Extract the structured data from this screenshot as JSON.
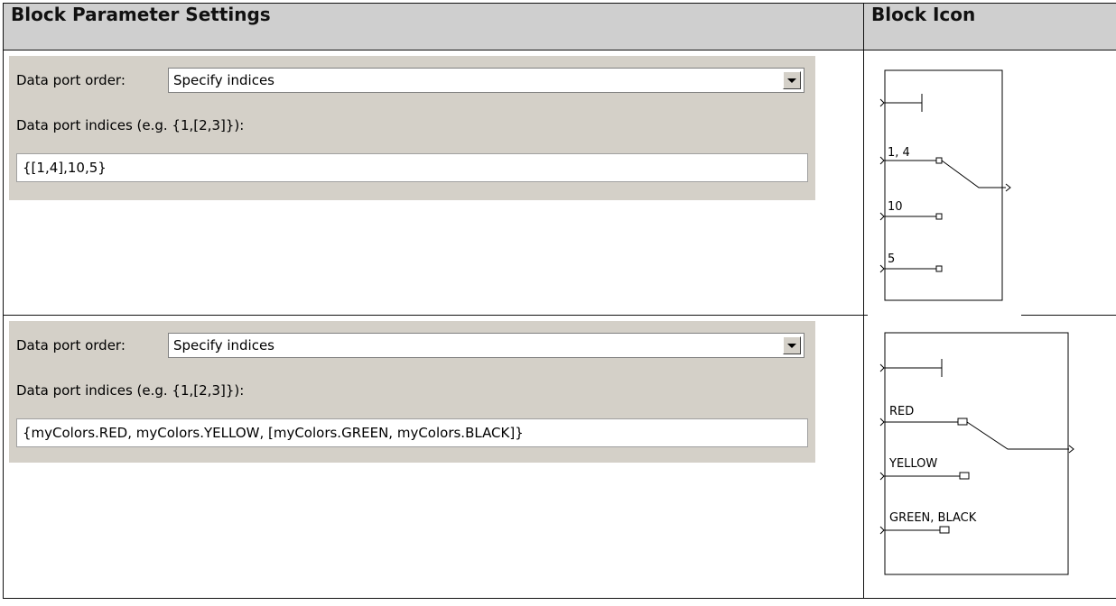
{
  "header": {
    "col1": "Block Parameter Settings",
    "col2": "Block Icon"
  },
  "rows": [
    {
      "order_label": "Data port order:",
      "order_value": "Specify indices",
      "indices_label": "Data port indices (e.g. {1,[2,3]}):",
      "indices_value": "{[1,4],10,5}",
      "icon_ports": [
        "1, 4",
        "10",
        "5"
      ]
    },
    {
      "order_label": "Data port order:",
      "order_value": "Specify indices",
      "indices_label": "Data port indices (e.g. {1,[2,3]}):",
      "indices_value": "{myColors.RED, myColors.YELLOW, [myColors.GREEN, myColors.BLACK]}",
      "icon_ports": [
        "RED",
        "YELLOW",
        "GREEN, BLACK"
      ]
    }
  ],
  "icons": {
    "combo_arrow": "chevron-down-icon",
    "block_icon": "multiport-switch-icon"
  }
}
